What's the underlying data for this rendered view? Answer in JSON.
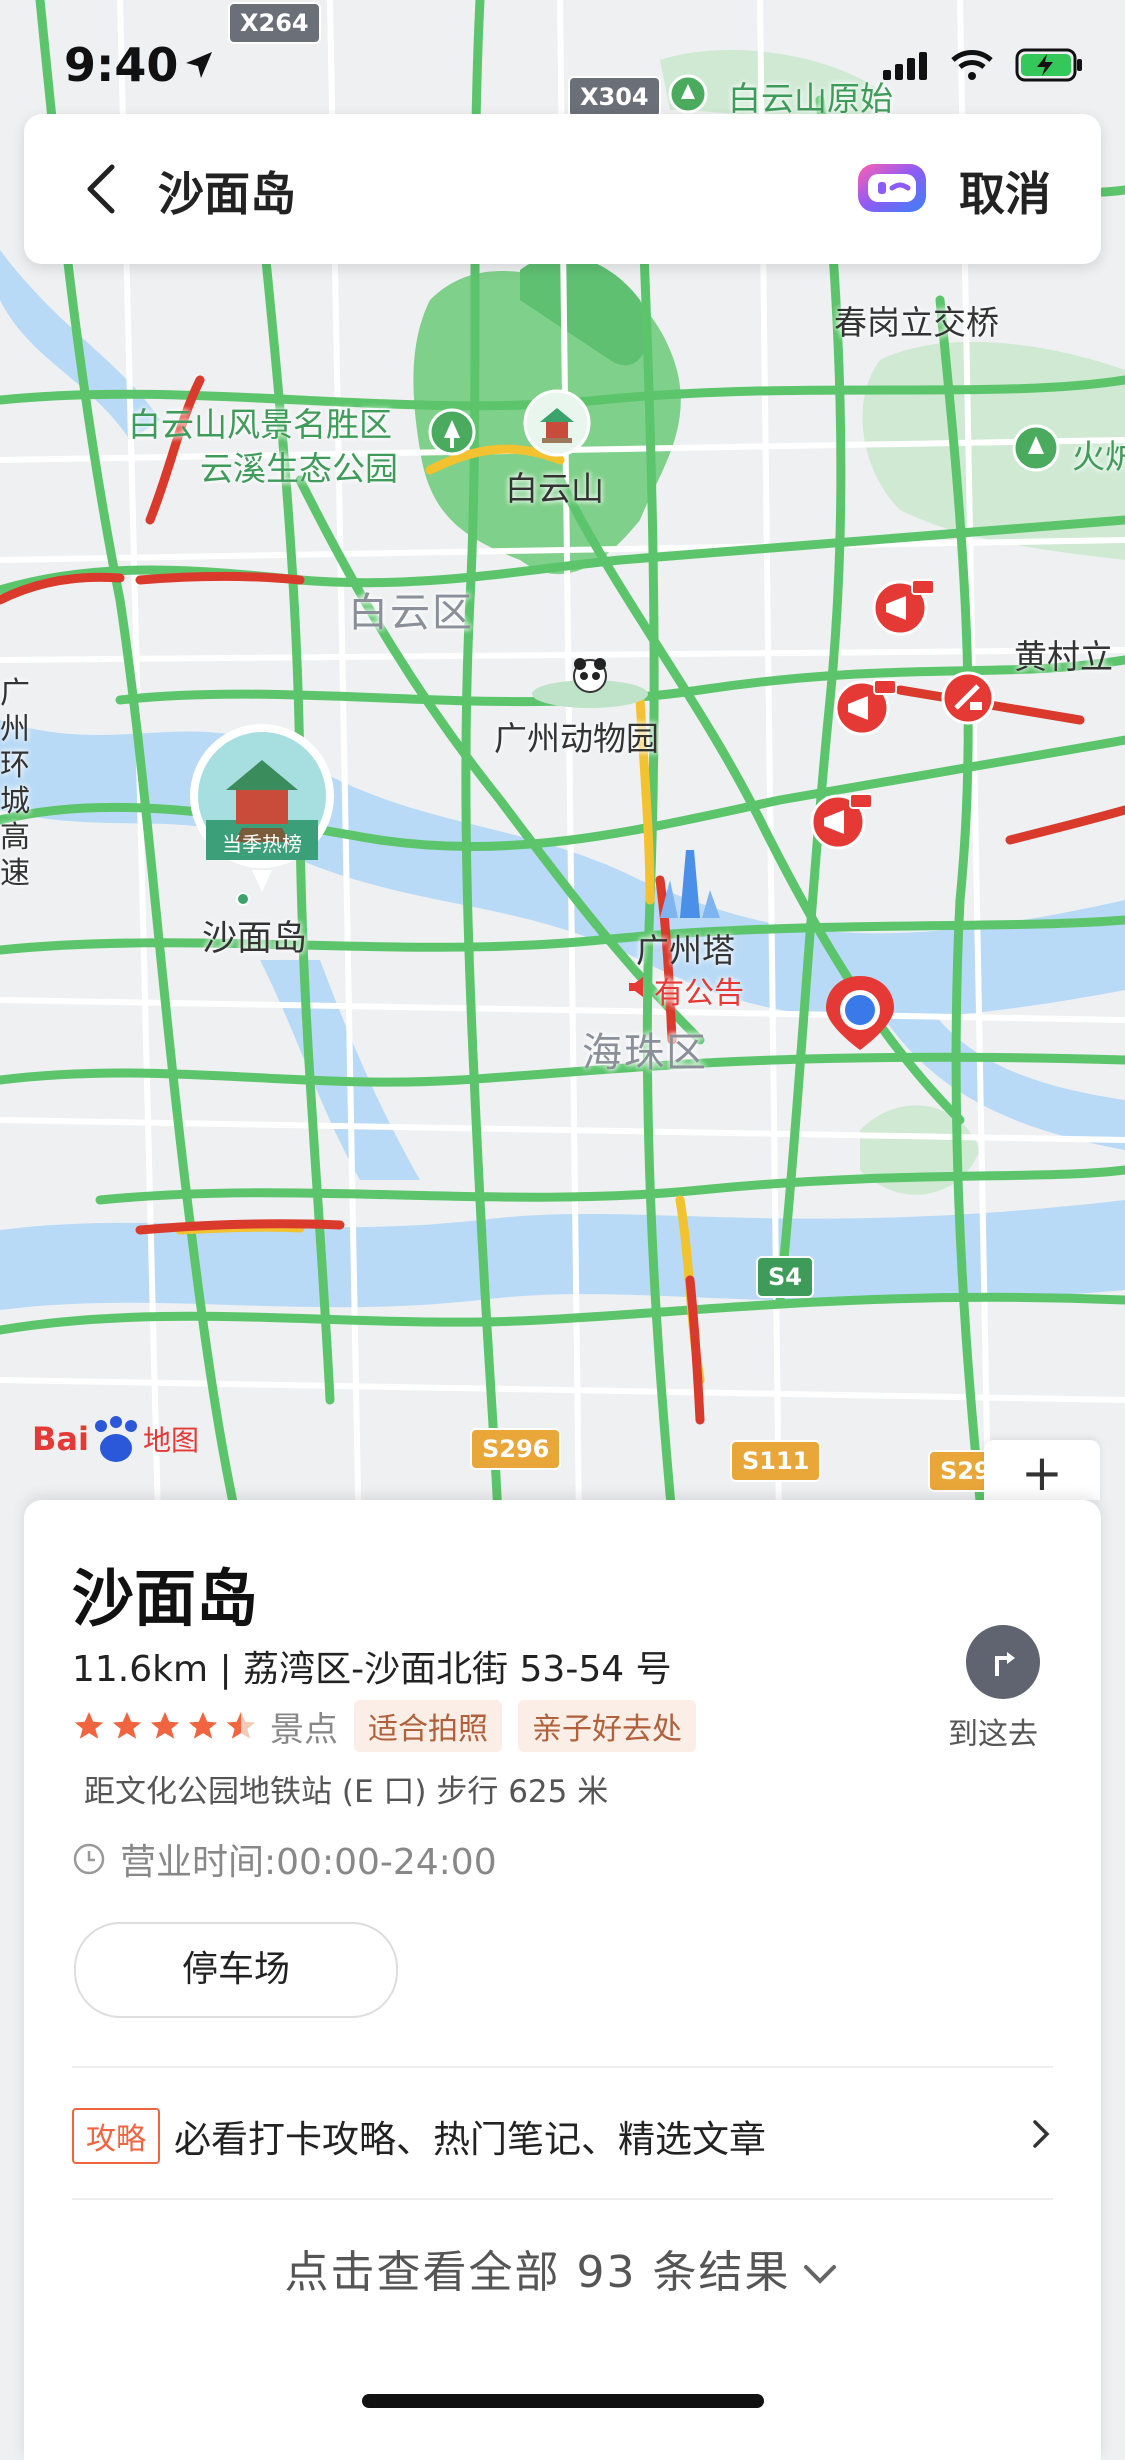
{
  "status_bar": {
    "time": "9:40"
  },
  "search": {
    "query": "沙面岛",
    "cancel_label": "取消"
  },
  "map": {
    "labels": {
      "baiyun_scenic": "白云山风景名胜区",
      "yunxi_park": "云溪生态公园",
      "baiyun_mountain": "白云山",
      "baiyun_district": "白云区",
      "zoo": "广州动物园",
      "canton_tower": "广州塔",
      "notice": "有公告",
      "haizhu_district": "海珠区",
      "shamian": "沙面岛",
      "season_hot": "当季热榜",
      "chungang_bridge": "春岗立交桥",
      "huangcun": "黄村立",
      "baiyun_yuan": "白云山原始",
      "huo": "火炉",
      "ring_expressway": "广州环城高速",
      "baidu_logo": "Bai",
      "baidu_map": "地图"
    },
    "shields": {
      "x264": "X264",
      "x304": "X304",
      "s4": "S4",
      "s296": "S296",
      "s111": "S111",
      "s29": "S29"
    },
    "zoom_in_label": "+"
  },
  "place": {
    "name": "沙面岛",
    "address": "11.6km | 荔湾区-沙面北街 53-54 号",
    "rating": 4.5,
    "category": "景点",
    "tags": [
      "适合拍照",
      "亲子好去处"
    ],
    "metro": "距文化公园地铁站 (E 口) 步行 625 米",
    "hours": "营业时间:00:00-24:00",
    "facility_button": "停车场",
    "navigate_label": "到这去",
    "guide_badge": "攻略",
    "guide_text": "必看打卡攻略、热门笔记、精选文章",
    "view_all": "点击查看全部 93 条结果"
  },
  "colors": {
    "traffic_green": "#5cc56c",
    "traffic_red": "#d93a2b",
    "traffic_yellow": "#f2c230",
    "water": "#b9daf6",
    "park": "#7fd08a",
    "location_blue": "#3a7ae8",
    "accent_orange": "#f06540"
  }
}
